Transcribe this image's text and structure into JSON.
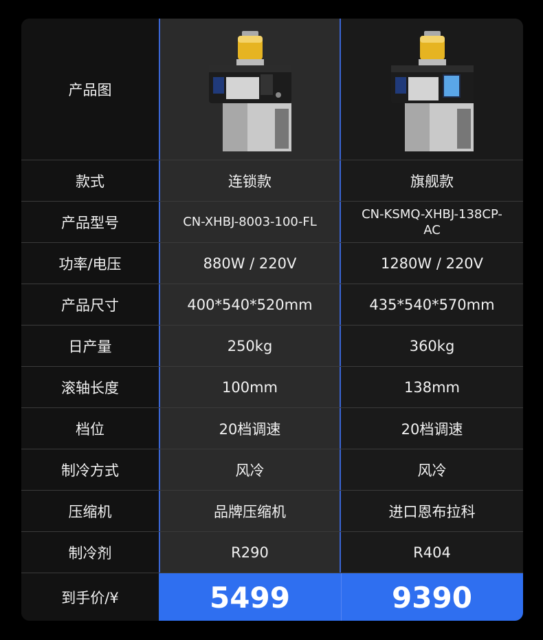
{
  "header": {
    "label": "产品图"
  },
  "products": [
    {
      "style": "连锁款",
      "model": "CN-XHBJ-8003-100-FL",
      "power": "880W / 220V",
      "size": "400*540*520mm",
      "daily_output": "250kg",
      "roller": "100mm",
      "gears": "20档调速",
      "cooling": "风冷",
      "compressor": "品牌压缩机",
      "refrigerant": "R290",
      "price": "5499"
    },
    {
      "style": "旗舰款",
      "model": "CN-KSMQ-XHBJ-138CP-AC",
      "power": "1280W / 220V",
      "size": "435*540*570mm",
      "daily_output": "360kg",
      "roller": "138mm",
      "gears": "20档调速",
      "cooling": "风冷",
      "compressor": "进口恩布拉科",
      "refrigerant": "R404",
      "price": "9390"
    }
  ],
  "labels": {
    "style": "款式",
    "model": "产品型号",
    "power": "功率/电压",
    "size": "产品尺寸",
    "daily_output": "日产量",
    "roller": "滚轴长度",
    "gears": "档位",
    "cooling": "制冷方式",
    "compressor": "压缩机",
    "refrigerant": "制冷剂",
    "price": "到手价/¥"
  },
  "colors": {
    "accent": "#2f6ff0",
    "highlight_border": "#3a66d6",
    "row_divider": "#3b3b3b"
  }
}
